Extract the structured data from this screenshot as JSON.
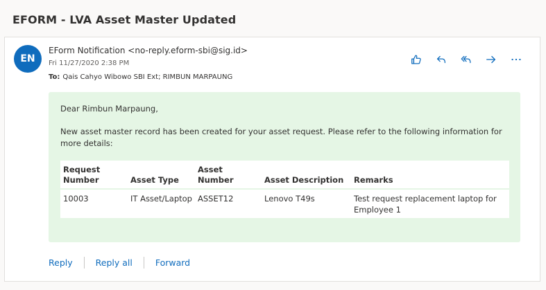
{
  "subject": "EFORM - LVA Asset Master Updated",
  "message": {
    "avatar_initials": "EN",
    "from": "EForm Notification <no-reply.eform-sbi@sig.id>",
    "date": "Fri 11/27/2020 2:38 PM",
    "to_label": "To:",
    "to": "Qais Cahyo Wibowo SBI Ext; RIMBUN MARPAUNG",
    "actions": [
      "like-icon",
      "reply-icon",
      "reply-all-icon",
      "forward-icon",
      "more-icon"
    ],
    "body": {
      "greeting": "Dear Rimbun Marpaung,",
      "text": "New asset master record has been created for your asset request. Please refer to the following information for more details:",
      "table": {
        "headers": [
          "Request Number",
          "Asset Type",
          "Asset Number",
          "Asset Description",
          "Remarks"
        ],
        "rows": [
          [
            "10003",
            "IT Asset/Laptop",
            "ASSET12",
            "Lenovo T49s",
            "Test request replacement laptop for Employee 1"
          ]
        ]
      },
      "background_color": "#e5f6e5"
    },
    "reply_actions": [
      "Reply",
      "Reply all",
      "Forward"
    ]
  },
  "colors": {
    "accent": "#0f6cbd",
    "avatar": "#0f6cbd"
  }
}
